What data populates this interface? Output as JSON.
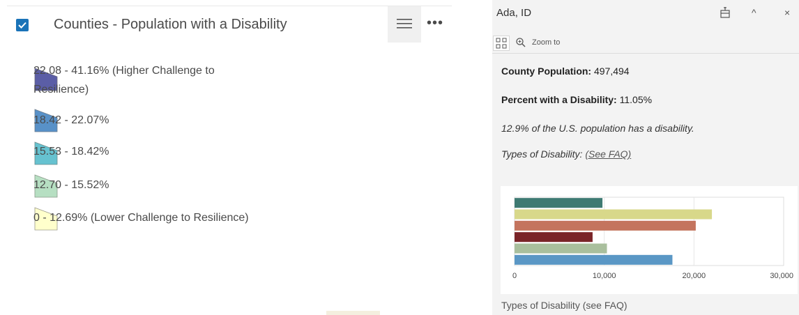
{
  "legend": {
    "layer_title": "Counties - Population with a Disability",
    "items": [
      {
        "label_line1": "22.08 - 41.16% (Higher Challenge to",
        "label_line2": "Resilience)",
        "color": "#5b5ea6"
      },
      {
        "label": "18.42 - 22.07%",
        "color": "#5891c8"
      },
      {
        "label": "15.53 - 18.42%",
        "color": "#66c2d0"
      },
      {
        "label": "12.70 - 15.52%",
        "color": "#b6dfc2"
      },
      {
        "label": "0 - 12.69% (Lower Challenge to Resilience)",
        "color": "#ffffcc"
      }
    ],
    "checkbox_icon": "checkbox-checked-icon",
    "list_icon": "list-icon",
    "more_icon": "more-options-icon"
  },
  "popup": {
    "title": "Ada, ID",
    "zoom_label": "Zoom to",
    "county_population_label": "County Population:",
    "county_population_value": "497,494",
    "percent_label": "Percent with a Disability:",
    "percent_value": "11.05%",
    "us_stat": "12.9% of the U.S. population has a disability.",
    "types_label": "Types of Disability:",
    "faq_link": "(See FAQ)",
    "chart_caption": "Types of Disability (see FAQ)"
  },
  "chart_data": {
    "type": "bar",
    "orientation": "horizontal",
    "categories": [
      "",
      "",
      "",
      "",
      "",
      ""
    ],
    "values": [
      9800,
      22000,
      20200,
      8700,
      10300,
      17600
    ],
    "colors": [
      "#3e7a72",
      "#d8d88a",
      "#c4745e",
      "#7a2428",
      "#a9bf9d",
      "#5a97c5"
    ],
    "xlim": [
      0,
      30000
    ],
    "xticks": [
      "0",
      "10,000",
      "20,000",
      "30,000"
    ],
    "grid": true
  }
}
